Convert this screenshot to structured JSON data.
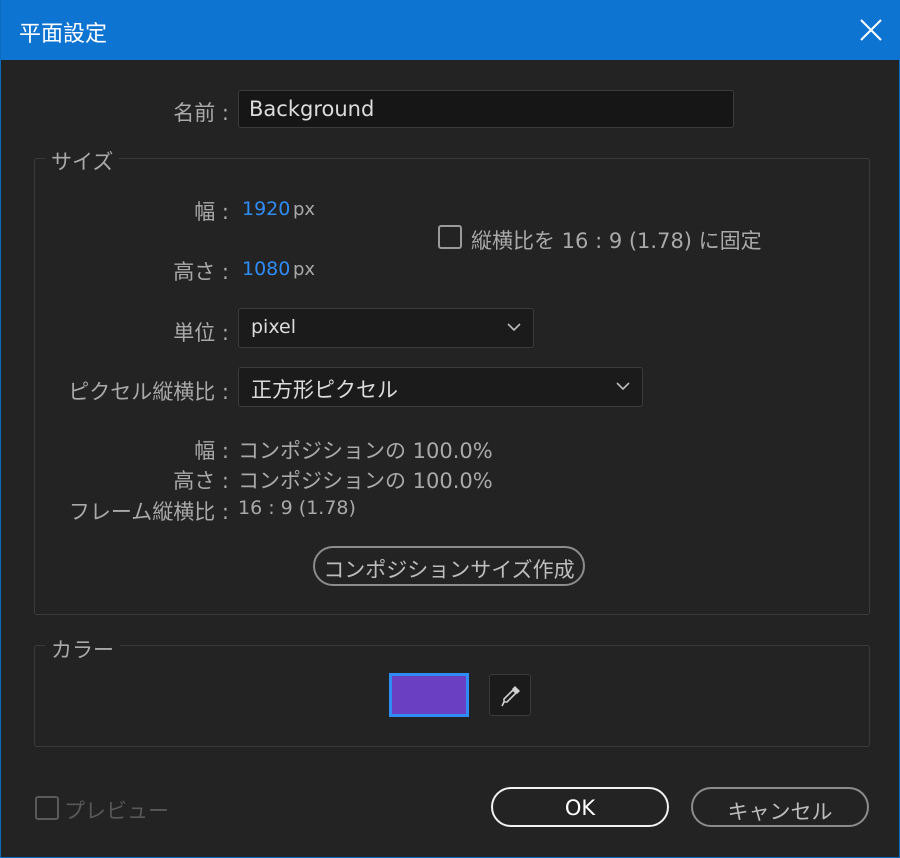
{
  "dialog": {
    "title": "平面設定"
  },
  "name_field": {
    "label": "名前 :",
    "value": "Background"
  },
  "size_group": {
    "legend": "サイズ",
    "width": {
      "label": "幅 :",
      "value": "1920",
      "unit": "px"
    },
    "height": {
      "label": "高さ :",
      "value": "1080",
      "unit": "px"
    },
    "lock_aspect": {
      "label": "縦横比を 16 : 9 (1.78) に固定",
      "checked": false
    },
    "units": {
      "label": "単位 :",
      "selected": "pixel"
    },
    "pixel_aspect": {
      "label": "ピクセル縦横比 :",
      "selected": "正方形ピクセル"
    },
    "width_info": {
      "label": "幅 :",
      "value": "コンポジションの 100.0%"
    },
    "height_info": {
      "label": "高さ :",
      "value": "コンポジションの 100.0%"
    },
    "frame_aspect": {
      "label": "フレーム縦横比 :",
      "value": "16 : 9 (1.78)"
    },
    "make_comp_size_label": "コンポジションサイズ作成"
  },
  "color_group": {
    "legend": "カラー",
    "swatch_color": "#6a3fc1",
    "eyedropper_icon": "eyedropper-icon"
  },
  "preview": {
    "label": "プレビュー",
    "checked": false
  },
  "buttons": {
    "ok": "OK",
    "cancel": "キャンセル"
  }
}
